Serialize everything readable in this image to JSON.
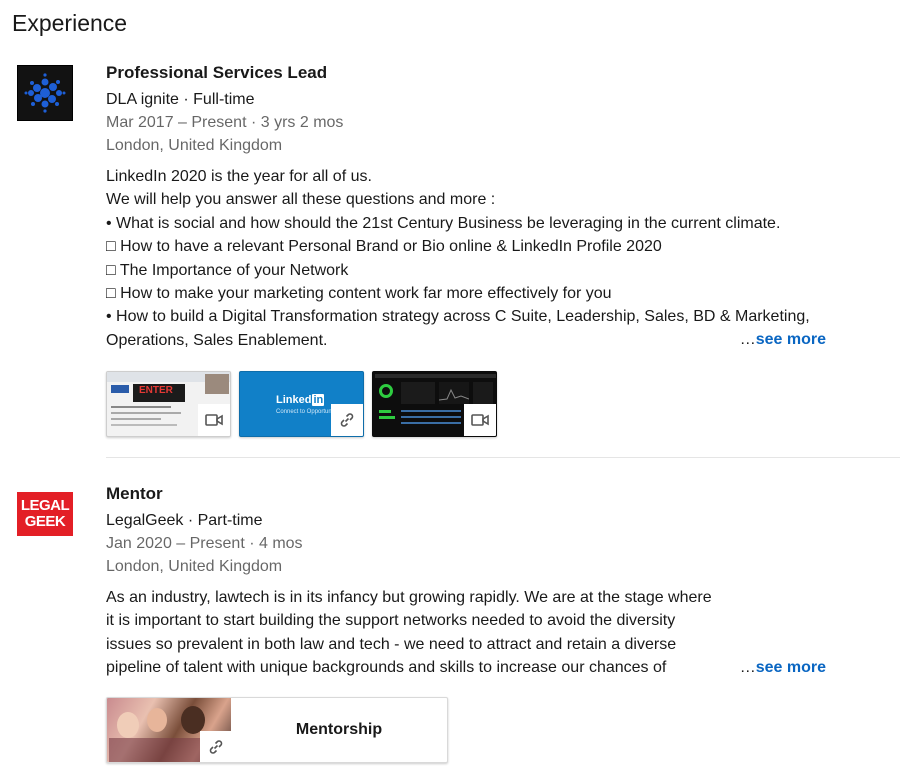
{
  "section": {
    "title": "Experience"
  },
  "entries": [
    {
      "title": "Professional Services Lead",
      "company": "DLA ignite · Full-time",
      "dates": "Mar 2017 – Present · 3 yrs 2 mos",
      "location": "London, United Kingdom",
      "description": [
        "LinkedIn 2020 is the year for all of us.",
        "We will help you answer all these questions and more :",
        "• What is social and how should the 21st Century Business be leveraging in the current climate.",
        "□ How to have a relevant Personal Brand or Bio online & LinkedIn Profile 2020",
        "□ The Importance of your Network",
        "□ How to make your marketing content work far more effectively for you",
        "• How to build a Digital Transformation strategy across C Suite, Leadership, Sales, BD & Marketing,",
        "Operations, Sales Enablement."
      ],
      "see_more_ellipsis": "…",
      "see_more_label": "see more",
      "media": [
        {
          "type": "video",
          "icon": "video-camera-icon",
          "thumb_text": "ENTER"
        },
        {
          "type": "link",
          "icon": "link-icon",
          "thumb_text": "Linked",
          "thumb_badge": "in",
          "thumb_sub": "Connect to Opportunity"
        },
        {
          "type": "video",
          "icon": "video-camera-icon"
        }
      ]
    },
    {
      "title": "Mentor",
      "company": "LegalGeek · Part-time",
      "dates": "Jan 2020 – Present · 4 mos",
      "location": "London, United Kingdom",
      "logo_lines": [
        "LEGAL",
        "GEEK"
      ],
      "description": [
        "As an industry, lawtech is in its infancy but growing rapidly. We are at the stage where",
        "it is important to start building the support networks needed to avoid the diversity",
        "issues so prevalent in both law and tech - we need to attract and retain a diverse",
        "pipeline of talent with unique backgrounds and skills to increase our chances of"
      ],
      "see_more_ellipsis": "…",
      "see_more_label": "see more",
      "media": [
        {
          "type": "link",
          "icon": "link-icon",
          "label": "Mentorship"
        }
      ]
    }
  ],
  "colors": {
    "link": "#0a66c2",
    "legalgeek_red": "#e31f26",
    "dla_blue": "#1e5fd6"
  }
}
